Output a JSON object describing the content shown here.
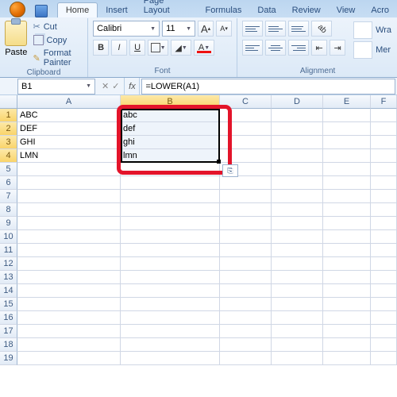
{
  "tabs": {
    "home": "Home",
    "insert": "Insert",
    "pagelayout": "Page Layout",
    "formulas": "Formulas",
    "data": "Data",
    "review": "Review",
    "view": "View",
    "acro_partial": "Acro"
  },
  "clipboard": {
    "paste": "Paste",
    "cut": "Cut",
    "copy": "Copy",
    "format_painter": "Format Painter",
    "group_label": "Clipboard"
  },
  "font": {
    "name": "Calibri",
    "size": "11",
    "grow": "A",
    "shrink": "A",
    "bold": "B",
    "italic": "I",
    "underline": "U",
    "fontcolor_letter": "A",
    "group_label": "Font"
  },
  "alignment": {
    "wrap_partial": "Wra",
    "merge_partial": "Mer",
    "group_label": "Alignment"
  },
  "namebox": "B1",
  "fx_label": "fx",
  "formula": "=LOWER(A1)",
  "columns": [
    "A",
    "B",
    "C",
    "D",
    "E",
    "F"
  ],
  "row_headers": [
    "1",
    "2",
    "3",
    "4",
    "5",
    "6",
    "7",
    "8",
    "9",
    "10",
    "11",
    "12",
    "13",
    "14",
    "15",
    "16",
    "17",
    "18",
    "19"
  ],
  "cells": {
    "A1": "ABC",
    "A2": "DEF",
    "A3": "GHI",
    "A4": "LMN",
    "B1": "abc",
    "B2": "def",
    "B3": "ghi",
    "B4": "lmn"
  },
  "selected_column_index": 1,
  "selected_rows": [
    0,
    1,
    2,
    3
  ],
  "autofill_glyph": "⎘"
}
